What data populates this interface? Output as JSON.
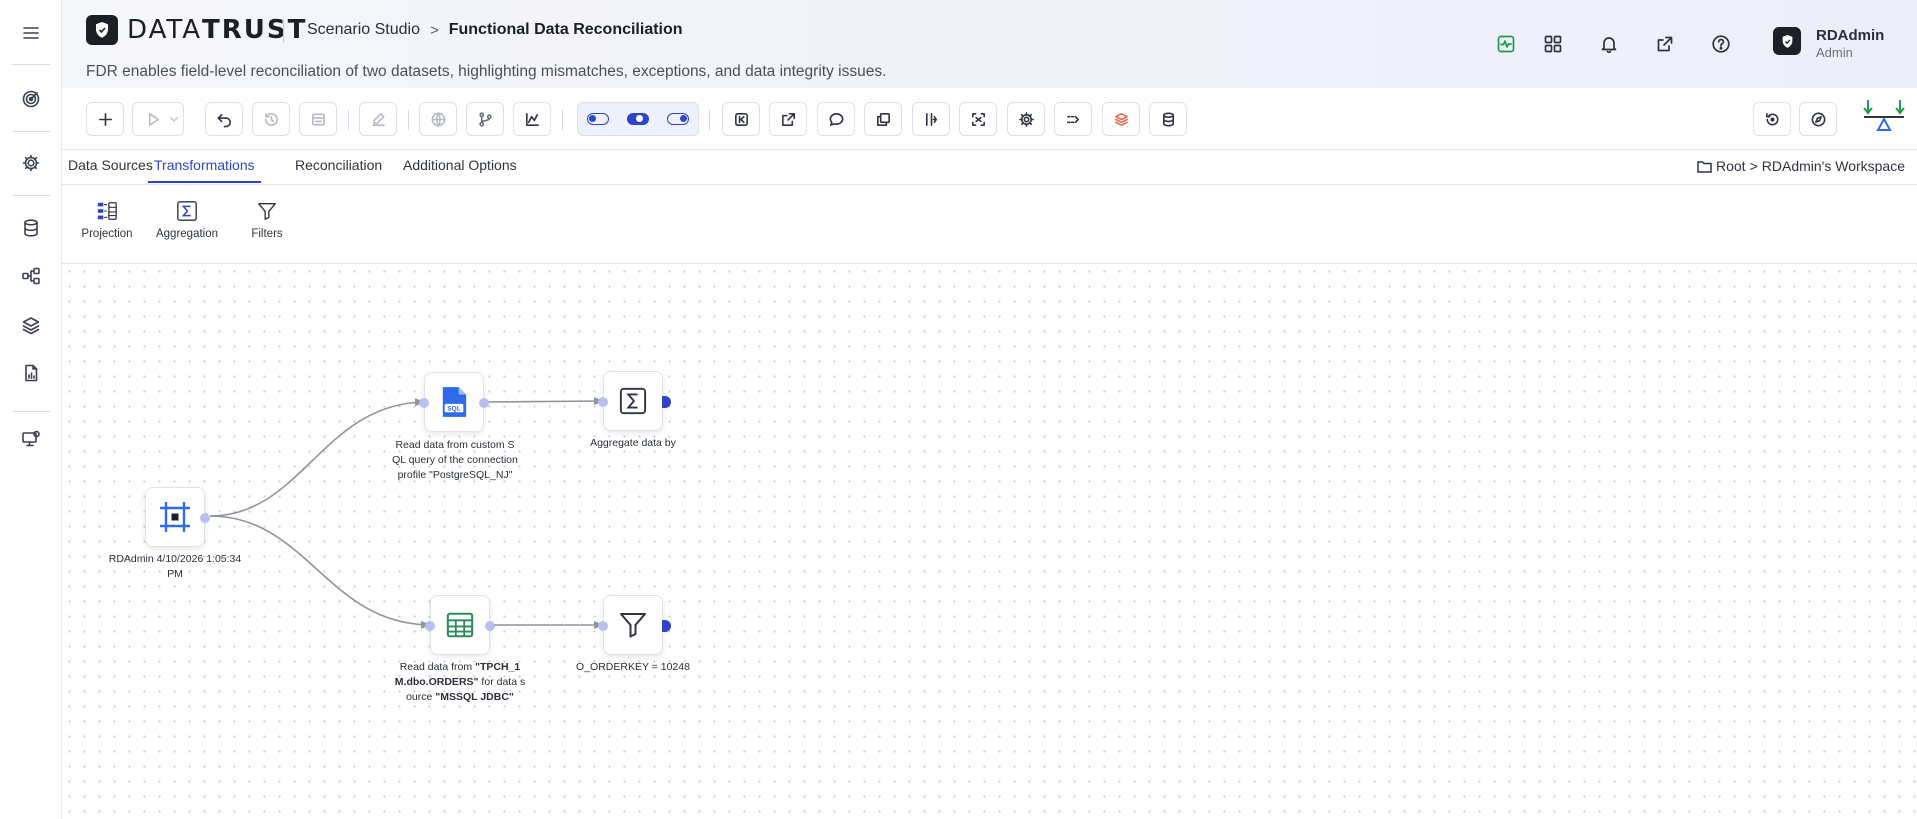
{
  "app": {
    "logo_text_light": "DATA",
    "logo_text_bold": "TRUST",
    "breadcrumb_parent": "Scenario Studio",
    "breadcrumb_sep": ">",
    "breadcrumb_current": "Functional Data Reconciliation",
    "subtitle": "FDR enables field-level reconciliation of two datasets, highlighting mismatches, exceptions, and data integrity issues."
  },
  "user": {
    "name": "RDAdmin",
    "role": "Admin"
  },
  "colors": {
    "accent": "#2f45c9",
    "green": "#1d9a4c",
    "orange": "#e8674a",
    "sql_blue": "#2f6be8",
    "table_green": "#2e8a5c"
  },
  "tabs": [
    {
      "label": "Data Sources",
      "active": false
    },
    {
      "label": "Transformations",
      "active": true
    },
    {
      "label": "Reconciliation",
      "active": false
    },
    {
      "label": "Additional Options",
      "active": false
    }
  ],
  "workspace": {
    "root": "Root",
    "sep": ">",
    "name": "RDAdmin's Workspace"
  },
  "palette": [
    {
      "label": "Projection",
      "icon": "projection-icon"
    },
    {
      "label": "Aggregation",
      "icon": "sigma-icon"
    },
    {
      "label": "Filters",
      "icon": "funnel-icon"
    }
  ],
  "nodes": {
    "source": {
      "label": "RDAdmin 4/10/2026 1:05:34 PM",
      "icon": "scenario-frame-icon"
    },
    "sql": {
      "label_lines": [
        "Read data from custom S",
        "QL query of the connection",
        "profile \"PostgreSQL_NJ\""
      ],
      "icon": "sql-file-icon"
    },
    "aggregate": {
      "label": "Aggregate data by",
      "icon": "sigma-icon"
    },
    "table": {
      "label_pre": "Read data from ",
      "label_bold1a": "\"TPCH_1",
      "label_bold1b": "M.dbo.ORDERS\"",
      "label_mid": " for data s",
      "label_mid2": "ource ",
      "label_bold2": "\"MSSQL JDBC\"",
      "icon": "table-icon"
    },
    "filter": {
      "label": "O_ORDERKEY = 10248",
      "icon": "funnel-icon"
    }
  }
}
